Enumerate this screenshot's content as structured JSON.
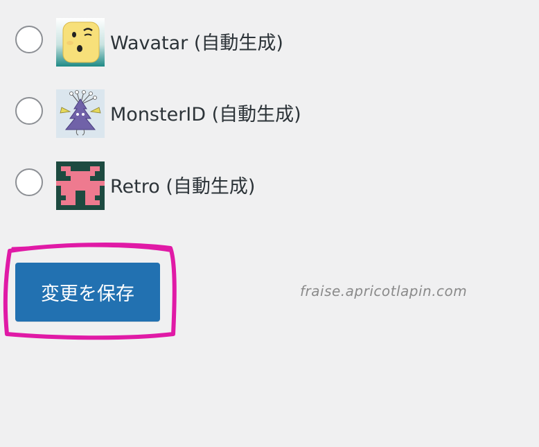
{
  "options": [
    {
      "label": "Wavatar (自動生成)",
      "avatar_icon": "wavatar-face-icon"
    },
    {
      "label": "MonsterID (自動生成)",
      "avatar_icon": "monsterid-monster-icon"
    },
    {
      "label": "Retro (自動生成)",
      "avatar_icon": "retro-pixel-icon"
    }
  ],
  "save_button": {
    "label": "変更を保存"
  },
  "watermark": {
    "text": "fraise.apricotlapin.com"
  },
  "colors": {
    "background": "#f0f0f1",
    "button": "#2271b1",
    "highlight": "#e01aa6",
    "retro_bg": "#1d4a40",
    "retro_fg": "#ee7a8f"
  }
}
